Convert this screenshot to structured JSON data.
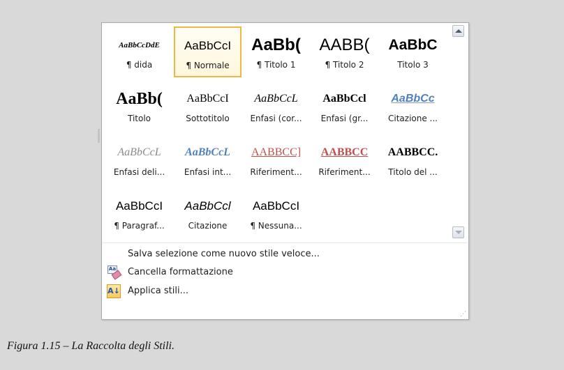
{
  "gallery": {
    "styles": [
      {
        "sample": "AaBbCcDdE",
        "name": "¶ dida",
        "selected": false
      },
      {
        "sample": "AaBbCcI",
        "name": "¶ Normale",
        "selected": true
      },
      {
        "sample": "AaBb(",
        "name": "¶ Titolo 1",
        "selected": false
      },
      {
        "sample": "AABB(",
        "name": "¶ Titolo 2",
        "selected": false
      },
      {
        "sample": "AaBbC",
        "name": "Titolo 3",
        "selected": false
      },
      {
        "sample": "AaBb(",
        "name": "Titolo",
        "selected": false
      },
      {
        "sample": "AaBbCcI",
        "name": "Sottotitolo",
        "selected": false
      },
      {
        "sample": "AaBbCcL",
        "name": "Enfasi (cor...",
        "selected": false
      },
      {
        "sample": "AaBbCcl",
        "name": "Enfasi (gr...",
        "selected": false
      },
      {
        "sample": "AaBbCc",
        "name": "Citazione ...",
        "selected": false
      },
      {
        "sample": "AaBbCcL",
        "name": "Enfasi deli...",
        "selected": false
      },
      {
        "sample": "AaBbCcL",
        "name": "Enfasi int...",
        "selected": false
      },
      {
        "sample": "AABBCC]",
        "name": "Riferiment...",
        "selected": false
      },
      {
        "sample": "AABBCC",
        "name": "Riferiment...",
        "selected": false
      },
      {
        "sample": "AABBCC.",
        "name": "Titolo del ...",
        "selected": false
      },
      {
        "sample": "AaBbCcI",
        "name": "¶ Paragraf...",
        "selected": false
      },
      {
        "sample": "AaBbCcl",
        "name": "Citazione",
        "selected": false
      },
      {
        "sample": "AaBbCcI",
        "name": "¶ Nessuna...",
        "selected": false
      }
    ],
    "scroll_up_icon": "chevron-up-icon",
    "scroll_down_icon": "chevron-down-icon"
  },
  "menu": {
    "save_selection": "Salva selezione come nuovo stile veloce...",
    "clear_formatting": "Cancella formattazione",
    "apply_styles": "Applica stili...",
    "clear_icon": "clear-formatting-icon",
    "apply_icon": "apply-styles-icon"
  },
  "caption": "Figura 1.15 – La Raccolta degli Stili.",
  "colors": {
    "selected_border": "#f0b743",
    "accent_blue": "#4f81bd",
    "accent_red": "#c0504d"
  }
}
